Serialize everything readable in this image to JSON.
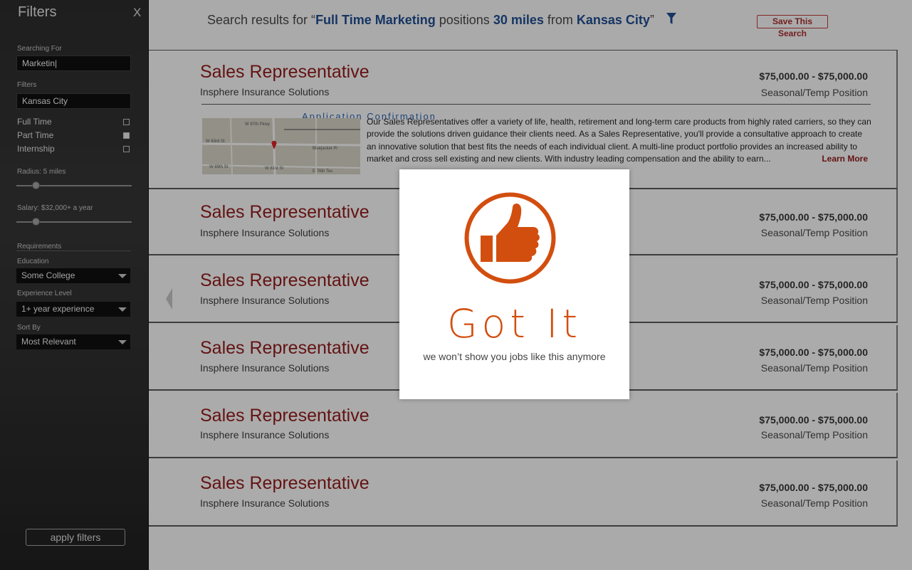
{
  "sidebar": {
    "title": "Filters",
    "close_label": "X",
    "searching_for_label": "Searching For",
    "search_value": "Marketin|",
    "filters_label": "Filters",
    "location_value": "Kansas City",
    "job_types": [
      {
        "label": "Full Time",
        "checked": false
      },
      {
        "label": "Part Time",
        "checked": true
      },
      {
        "label": "Internship",
        "checked": false
      }
    ],
    "radius_label": "Radius: 5 miles",
    "salary_label": "Salary: $32,000+ a year",
    "requirements_label": "Requirements",
    "education_label": "Education",
    "education_value": "Some College",
    "experience_label": "Experience Level",
    "experience_value": "1+ year experience",
    "sortby_label": "Sort By",
    "sortby_value": "Most Relevant",
    "apply_label": "apply filters"
  },
  "header": {
    "prefix": "Search results for “",
    "query": "Full Time Marketing",
    "mid1": " positions ",
    "distance": "30 miles",
    "mid2": " from ",
    "location": "Kansas City",
    "suffix": "”",
    "save_label": "Save This Search"
  },
  "jobs": [
    {
      "title": "Sales Representative",
      "company": "Insphere Insurance Solutions",
      "salary": "$75,000.00 - $75,000.00",
      "type": "Seasonal/Temp Position",
      "status": "Application Confirmation",
      "description": "Our Sales Representatives offer a variety of life, health, retirement and long-term care products from highly rated carriers, so they can provide the solutions driven guidance their clients need. As a Sales Representative, you'll provide a consultative approach to create an innovative solution that best fits the needs of each individual client. A multi-line product portfolio provides an increased ability to market and cross sell existing and new clients. With industry leading compensation and the ability to earn...",
      "learn_more": "Learn More",
      "map_labels": [
        "W 83rd St",
        "W 87th Pkwy",
        "W 89th St",
        "Bluejacket Pl",
        "W 81st St",
        "E 76th Tes"
      ]
    },
    {
      "title": "Sales Representative",
      "company": "Insphere Insurance Solutions",
      "salary": "$75,000.00 - $75,000.00",
      "type": "Seasonal/Temp Position"
    },
    {
      "title": "Sales Representative",
      "company": "Insphere Insurance Solutions",
      "salary": "$75,000.00 - $75,000.00",
      "type": "Seasonal/Temp Position"
    },
    {
      "title": "Sales Representative",
      "company": "Insphere Insurance Solutions",
      "salary": "$75,000.00 - $75,000.00",
      "type": "Seasonal/Temp Position"
    },
    {
      "title": "Sales Representative",
      "company": "Insphere Insurance Solutions",
      "salary": "$75,000.00 - $75,000.00",
      "type": "Seasonal/Temp Position"
    },
    {
      "title": "Sales Representative",
      "company": "Insphere Insurance Solutions",
      "salary": "$75,000.00 - $75,000.00",
      "type": "Seasonal/Temp Position"
    }
  ],
  "modal": {
    "icon": "thumbs-up-icon",
    "heading": "Got It",
    "message": "we won’t show you jobs like this anymore"
  },
  "colors": {
    "accent_orange": "#d24e0f",
    "title_red": "#8b1a1a",
    "link_blue": "#1f4a8a"
  }
}
